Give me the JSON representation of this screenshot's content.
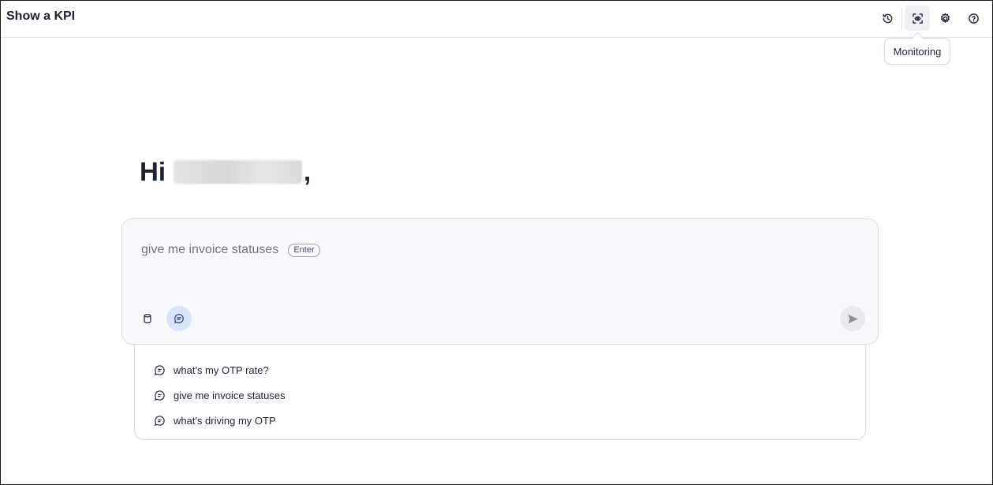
{
  "app": {
    "title": "Show a KPI"
  },
  "toolbar": {
    "items": [
      {
        "icon": "history-icon"
      },
      {
        "icon": "monitoring-icon"
      },
      {
        "icon": "gear-icon"
      },
      {
        "icon": "help-icon"
      }
    ],
    "tooltip": "Monitoring"
  },
  "greeting": {
    "prefix": "Hi",
    "suffix": ","
  },
  "prompt": {
    "placeholder_suggestion": "give me invoice statuses",
    "enter_label": "Enter"
  },
  "suggestions": [
    {
      "label": "what's my OTP rate?"
    },
    {
      "label": "give me invoice statuses"
    },
    {
      "label": "what's driving my OTP"
    }
  ],
  "colors": {
    "active_chat_bg": "#d8e4fb",
    "text_primary": "#1b2234"
  }
}
